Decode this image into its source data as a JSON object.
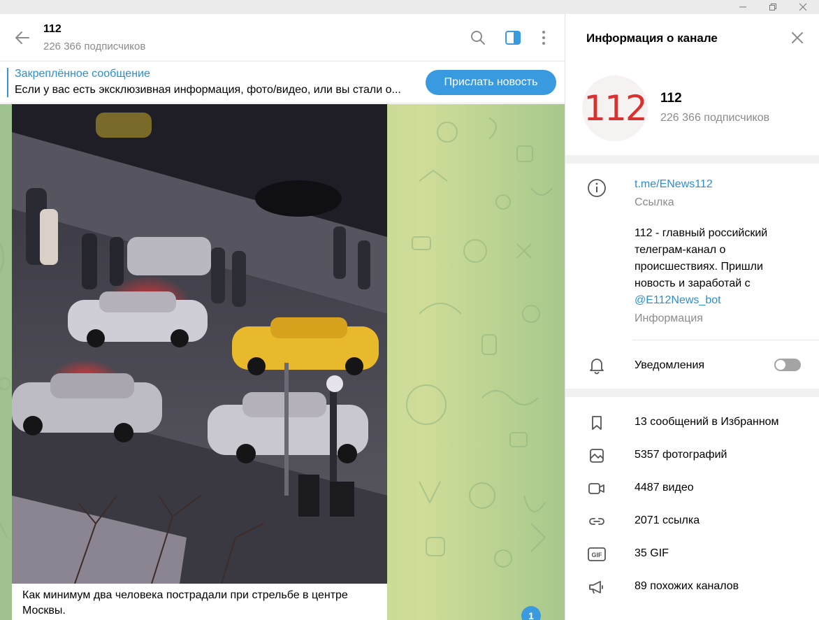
{
  "window": {
    "minimize_glyph": "—",
    "maximize_glyph": "❐",
    "close_glyph": "✕"
  },
  "chat": {
    "title": "112",
    "subscribers": "226 366 подписчиков",
    "pinned": {
      "title": "Закреплённое сообщение",
      "text": "Если у вас есть эксклюзивная информация, фото/видео, или вы стали о..."
    },
    "send_news_button": "Прислать новость",
    "message": {
      "caption": "Как минимум два человека пострадали при стрельбе в центре Москвы."
    },
    "unread_count": "1"
  },
  "info_panel": {
    "title": "Информация о канале",
    "avatar_text": "112",
    "name": "112",
    "subscribers": "226 366 подписчиков",
    "link": {
      "value": "t.me/ENews112",
      "label": "Ссылка"
    },
    "description": {
      "text": "112 - главный российский телеграм-канал о происшествиях. Пришли новость и заработай с",
      "mention": "@E112News_bot",
      "label": "Информация"
    },
    "notifications": {
      "label": "Уведомления",
      "enabled": false
    },
    "media": [
      {
        "icon": "bookmark-icon",
        "label": "13 сообщений в Избранном"
      },
      {
        "icon": "photo-icon",
        "label": "5357 фотографий"
      },
      {
        "icon": "video-icon",
        "label": "4487 видео"
      },
      {
        "icon": "link-icon",
        "label": "2071 ссылка"
      },
      {
        "icon": "gif-icon",
        "label": "35 GIF"
      },
      {
        "icon": "megaphone-icon",
        "label": "89 похожих каналов"
      }
    ]
  },
  "colors": {
    "accent": "#3a9ae0",
    "link": "#2a8fd2",
    "secondary_text": "#8b8b8b",
    "avatar_red": "#d93030"
  }
}
